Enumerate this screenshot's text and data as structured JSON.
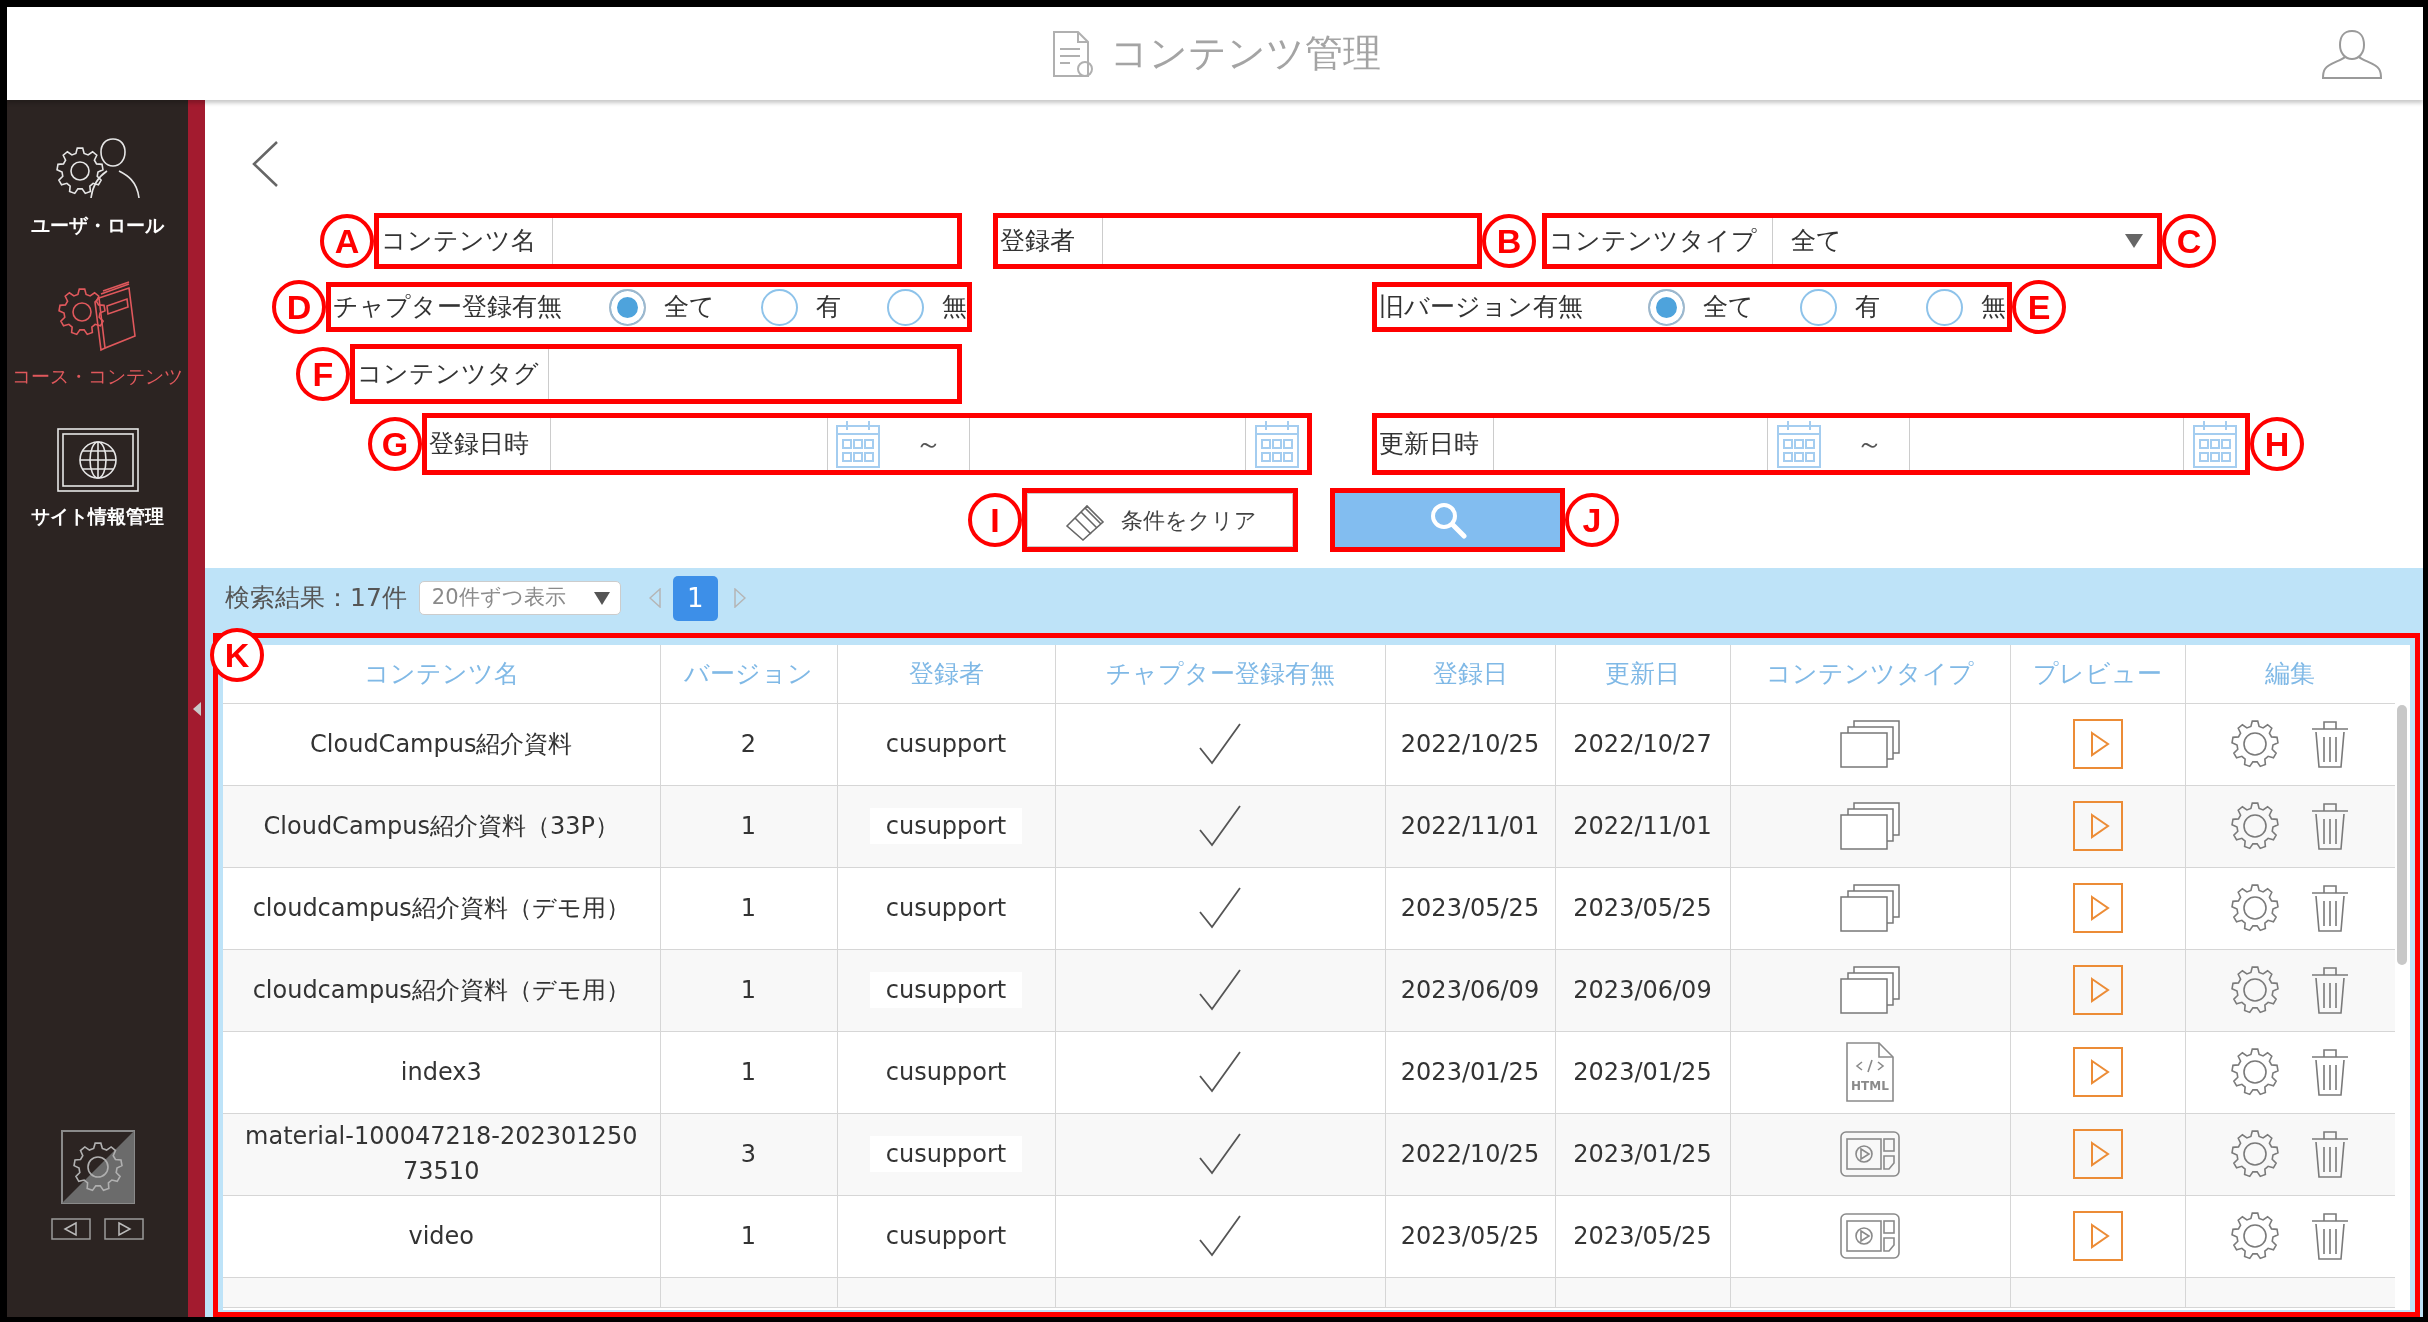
{
  "header": {
    "title": "コンテンツ管理"
  },
  "sidebar": {
    "items": [
      {
        "label": "ユーザ・ロール",
        "selected": false
      },
      {
        "label": "コース・コンテンツ",
        "selected": true
      },
      {
        "label": "サイト情報管理",
        "selected": false
      }
    ]
  },
  "search_form": {
    "fields": [
      {
        "kind": "text",
        "label": "コンテンツ名",
        "callout": "A"
      },
      {
        "kind": "text",
        "label": "登録者",
        "callout": "B"
      },
      {
        "kind": "select",
        "label": "コンテンツタイプ",
        "value": "全て",
        "callout": "C"
      },
      {
        "kind": "radio",
        "label": "チャプター登録有無",
        "options": [
          {
            "label": "全て",
            "selected": true
          },
          {
            "label": "有",
            "selected": false
          },
          {
            "label": "無",
            "selected": false
          }
        ],
        "callout": "D"
      },
      {
        "kind": "radio",
        "label": "旧バージョン有無",
        "options": [
          {
            "label": "全て",
            "selected": true
          },
          {
            "label": "有",
            "selected": false
          },
          {
            "label": "無",
            "selected": false
          }
        ],
        "callout": "E"
      },
      {
        "kind": "text",
        "label": "コンテンツタグ",
        "callout": "F"
      },
      {
        "kind": "daterange",
        "label": "登録日時",
        "separator": "～",
        "callout": "G"
      },
      {
        "kind": "daterange",
        "label": "更新日時",
        "separator": "～",
        "callout": "H"
      }
    ],
    "buttons": [
      {
        "kind": "clear",
        "label": "条件をクリア",
        "callout": "I"
      },
      {
        "kind": "search",
        "callout": "J"
      }
    ]
  },
  "results": {
    "summary": "検索結果：17件",
    "page_size": "20件ずつ表示",
    "pages": [
      {
        "label": "1",
        "selected": true
      }
    ],
    "callout": "K",
    "table": {
      "columns": [
        "コンテンツ名",
        "バージョン",
        "登録者",
        "チャプター登録有無",
        "登録日",
        "更新日",
        "コンテンツタイプ",
        "プレビュー",
        "編集"
      ],
      "rows": [
        {
          "name": "CloudCampus紹介資料",
          "version": "2",
          "registrant": "cusupport",
          "chapter": true,
          "registered": "2022/10/25",
          "updated": "2022/10/27",
          "kind": "slides"
        },
        {
          "name": "CloudCampus紹介資料（33P）",
          "version": "1",
          "registrant": "cusupport",
          "chapter": true,
          "registered": "2022/11/01",
          "updated": "2022/11/01",
          "kind": "slides"
        },
        {
          "name": "cloudcampus紹介資料（デモ用）",
          "version": "1",
          "registrant": "cusupport",
          "chapter": true,
          "registered": "2023/05/25",
          "updated": "2023/05/25",
          "kind": "slides"
        },
        {
          "name": "cloudcampus紹介資料（デモ用）",
          "version": "1",
          "registrant": "cusupport",
          "chapter": true,
          "registered": "2023/06/09",
          "updated": "2023/06/09",
          "kind": "slides"
        },
        {
          "name": "index3",
          "version": "1",
          "registrant": "cusupport",
          "chapter": true,
          "registered": "2023/01/25",
          "updated": "2023/01/25",
          "kind": "html",
          "type_label": "HTML"
        },
        {
          "name": "material-100047218-20230125073510",
          "version": "3",
          "registrant": "cusupport",
          "chapter": true,
          "registered": "2022/10/25",
          "updated": "2023/01/25",
          "kind": "video"
        },
        {
          "name": "video",
          "version": "1",
          "registrant": "cusupport",
          "chapter": true,
          "registered": "2023/05/25",
          "updated": "2023/05/25",
          "kind": "video"
        }
      ]
    }
  }
}
